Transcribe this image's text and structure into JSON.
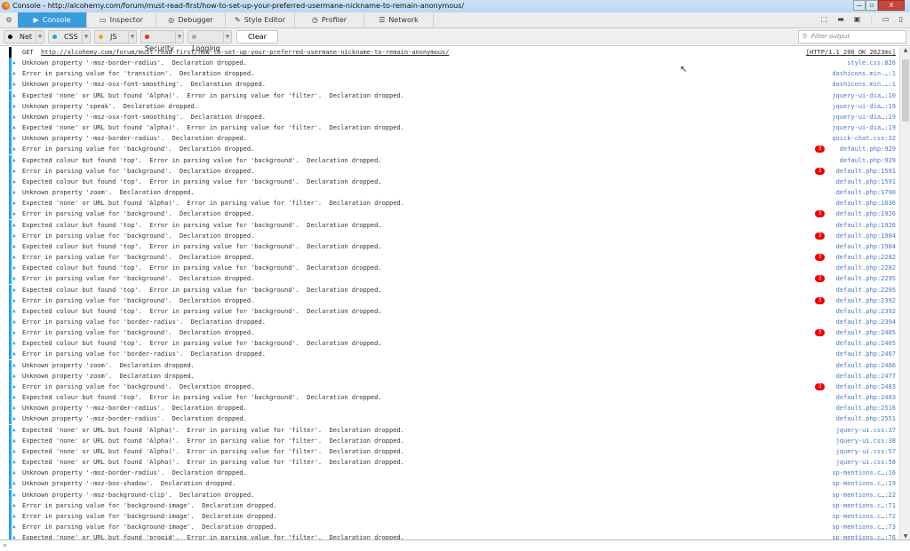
{
  "window": {
    "title": "Console - http://alcohemy.com/forum/must-read-first/how-to-set-up-your-preferred-usermane-nickname-to-remain-anonymous/",
    "minimize": "—",
    "maximize": "▫",
    "close": "X"
  },
  "tabs": [
    {
      "label": "Console",
      "icon": "▶",
      "active": true
    },
    {
      "label": "Inspector",
      "icon": "▭"
    },
    {
      "label": "Debugger",
      "icon": "◎"
    },
    {
      "label": "Style Editor",
      "icon": "✎"
    },
    {
      "label": "Profiler",
      "icon": "◷"
    },
    {
      "label": "Network",
      "icon": "☰"
    }
  ],
  "filters": [
    {
      "label": "Net",
      "color": "#111111"
    },
    {
      "label": "CSS",
      "color": "#23a4e6"
    },
    {
      "label": "JS",
      "color": "#f0a020"
    },
    {
      "label": "Security",
      "color": "#e03030"
    },
    {
      "label": "Logging",
      "color": "#aaaaaa"
    }
  ],
  "clear_label": "Clear",
  "filter_placeholder": "Filter output",
  "colors": {
    "accent": "#3a9bdc",
    "css_warning": "#23a4e6",
    "badge": "#ee0000"
  },
  "request": {
    "method": "GET",
    "url": "http://alcohemy.com/forum/must-read-first/how-to-set-up-your-preferred-usermane-nickname-to-remain-anonymous/",
    "status": "[HTTP/1.1 200 OK 2623ms]"
  },
  "messages": [
    {
      "text": "Unknown property '-moz-border-radius'.  Declaration dropped.",
      "source": "style.css:826"
    },
    {
      "text": "Error in parsing value for 'transition'.  Declaration dropped.",
      "source": "dashicons.min.…:1"
    },
    {
      "text": "Unknown property '-moz-osx-font-smoothing'.  Declaration dropped.",
      "source": "dashicons.min.…:1"
    },
    {
      "text": "Expected 'none' or URL but found 'Alpha('.  Error in parsing value for 'filter'.  Declaration dropped.",
      "source": "jquery-ui-dia…:10"
    },
    {
      "text": "Unknown property 'speak'.  Declaration dropped.",
      "source": "jquery-ui-dia…:19"
    },
    {
      "text": "Unknown property '-moz-osx-font-smoothing'.  Declaration dropped.",
      "source": "jquery-ui-dia…:19"
    },
    {
      "text": "Expected 'none' or URL but found 'alpha('.  Error in parsing value for 'filter'.  Declaration dropped.",
      "source": "jquery-ui-dia…:19"
    },
    {
      "text": "Unknown property '-moz-border-radius'.  Declaration dropped.",
      "source": "quick-chat.css:32"
    },
    {
      "text": "Error in parsing value for 'background'.  Declaration dropped.",
      "source": "default.php:929",
      "count": "3"
    },
    {
      "text": "Expected colour but found 'top'.  Error in parsing value for 'background'.  Declaration dropped.",
      "source": "default.php:929"
    },
    {
      "text": "Error in parsing value for 'background'.  Declaration dropped.",
      "source": "default.php:1591",
      "count": "3"
    },
    {
      "text": "Expected colour but found 'top'.  Error in parsing value for 'background'.  Declaration dropped.",
      "source": "default.php:1591"
    },
    {
      "text": "Unknown property 'zoom'.  Declaration dropped.",
      "source": "default.php:1790"
    },
    {
      "text": "Expected 'none' or URL but found 'Alpha('.  Error in parsing value for 'filter'.  Declaration dropped.",
      "source": "default.php:1836"
    },
    {
      "text": "Error in parsing value for 'background'.  Declaration dropped.",
      "source": "default.php:1926",
      "count": "3"
    },
    {
      "text": "Expected colour but found 'top'.  Error in parsing value for 'background'.  Declaration dropped.",
      "source": "default.php:1926"
    },
    {
      "text": "Error in parsing value for 'background'.  Declaration dropped.",
      "source": "default.php:1984",
      "count": "3"
    },
    {
      "text": "Expected colour but found 'top'.  Error in parsing value for 'background'.  Declaration dropped.",
      "source": "default.php:1984"
    },
    {
      "text": "Error in parsing value for 'background'.  Declaration dropped.",
      "source": "default.php:2282",
      "count": "3"
    },
    {
      "text": "Expected colour but found 'top'.  Error in parsing value for 'background'.  Declaration dropped.",
      "source": "default.php:2282"
    },
    {
      "text": "Error in parsing value for 'background'.  Declaration dropped.",
      "source": "default.php:2295",
      "count": "3"
    },
    {
      "text": "Expected colour but found 'top'.  Error in parsing value for 'background'.  Declaration dropped.",
      "source": "default.php:2295"
    },
    {
      "text": "Error in parsing value for 'background'.  Declaration dropped.",
      "source": "default.php:2392",
      "count": "3"
    },
    {
      "text": "Expected colour but found 'top'.  Error in parsing value for 'background'.  Declaration dropped.",
      "source": "default.php:2392"
    },
    {
      "text": "Error in parsing value for 'border-radius'.  Declaration dropped.",
      "source": "default.php:2394"
    },
    {
      "text": "Error in parsing value for 'background'.  Declaration dropped.",
      "source": "default.php:2405",
      "count": "3"
    },
    {
      "text": "Expected colour but found 'top'.  Error in parsing value for 'background'.  Declaration dropped.",
      "source": "default.php:2405"
    },
    {
      "text": "Error in parsing value for 'border-radius'.  Declaration dropped.",
      "source": "default.php:2407"
    },
    {
      "text": "Unknown property 'zoom'.  Declaration dropped.",
      "source": "default.php:2466"
    },
    {
      "text": "Unknown property 'zoom'.  Declaration dropped.",
      "source": "default.php:2477"
    },
    {
      "text": "Error in parsing value for 'background'.  Declaration dropped.",
      "source": "default.php:2483",
      "count": "3"
    },
    {
      "text": "Expected colour but found 'top'.  Error in parsing value for 'background'.  Declaration dropped.",
      "source": "default.php:2483"
    },
    {
      "text": "Unknown property '-moz-border-radius'.  Declaration dropped.",
      "source": "default.php:2516"
    },
    {
      "text": "Unknown property '-moz-border-radius'.  Declaration dropped.",
      "source": "default.php:2551"
    },
    {
      "text": "Expected 'none' or URL but found 'Alpha('.  Error in parsing value for 'filter'.  Declaration dropped.",
      "source": "jquery-ui.css:37"
    },
    {
      "text": "Expected 'none' or URL but found 'Alpha('.  Error in parsing value for 'filter'.  Declaration dropped.",
      "source": "jquery-ui.css:38"
    },
    {
      "text": "Expected 'none' or URL but found 'Alpha('.  Error in parsing value for 'filter'.  Declaration dropped.",
      "source": "jquery-ui.css:57"
    },
    {
      "text": "Expected 'none' or URL but found 'Alpha('.  Error in parsing value for 'filter'.  Declaration dropped.",
      "source": "jquery-ui.css:58"
    },
    {
      "text": "Unknown property '-moz-border-radius'.  Declaration dropped.",
      "source": "sp-mentions.c…:16"
    },
    {
      "text": "Unknown property '-moz-box-shadow'.  Declaration dropped.",
      "source": "sp-mentions.c…:19"
    },
    {
      "text": "Unknown property '-moz-background-clip'.  Declaration dropped.",
      "source": "sp-mentions.c…:22"
    },
    {
      "text": "Error in parsing value for 'background-image'.  Declaration dropped.",
      "source": "sp-mentions.c…:71"
    },
    {
      "text": "Error in parsing value for 'background-image'.  Declaration dropped.",
      "source": "sp-mentions.c…:72"
    },
    {
      "text": "Error in parsing value for 'background-image'.  Declaration dropped.",
      "source": "sp-mentions.c…:73"
    },
    {
      "text": "Expected 'none' or URL but found 'progid'.  Error in parsing value for 'filter'.  Declaration dropped.",
      "source": "sp-mentions.c…:76"
    }
  ],
  "input_prompt": "»"
}
